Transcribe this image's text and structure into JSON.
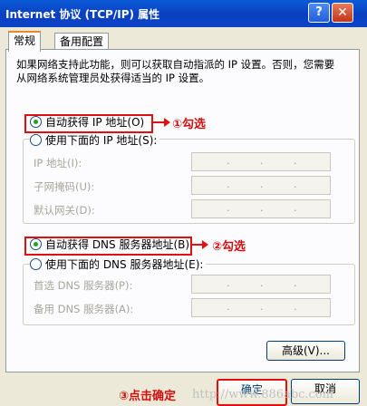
{
  "window": {
    "title": "Internet 协议 (TCP/IP) 属性",
    "help": "?",
    "close": "✕"
  },
  "tabs": [
    {
      "label": "常规"
    },
    {
      "label": "备用配置"
    }
  ],
  "description": "如果网络支持此功能，则可以获取自动指派的 IP 设置。否则，您需要从网络系统管理员处获得适当的 IP 设置。",
  "ip": {
    "auto_label": "自动获得 IP 地址(O)",
    "manual_label": "使用下面的 IP 地址(S):",
    "fields": [
      {
        "label": "IP 地址(I):"
      },
      {
        "label": "子网掩码(U):"
      },
      {
        "label": "默认网关(D):"
      }
    ]
  },
  "dns": {
    "auto_label": "自动获得 DNS 服务器地址(B)",
    "manual_label": "使用下面的 DNS 服务器地址(E):",
    "fields": [
      {
        "label": "首选 DNS 服务器(P):"
      },
      {
        "label": "备用 DNS 服务器(A):"
      }
    ]
  },
  "annotations": {
    "step1": "①勾选",
    "step2": "②勾选",
    "step3": "③点击确定"
  },
  "buttons": {
    "advanced": "高级(V)...",
    "ok": "确定",
    "cancel": "取消"
  },
  "watermark": "http://www.886abc.com",
  "colors": {
    "titlebar": "#0a3fc0",
    "annotation": "#e01010",
    "radio_selected": "#21a121"
  }
}
